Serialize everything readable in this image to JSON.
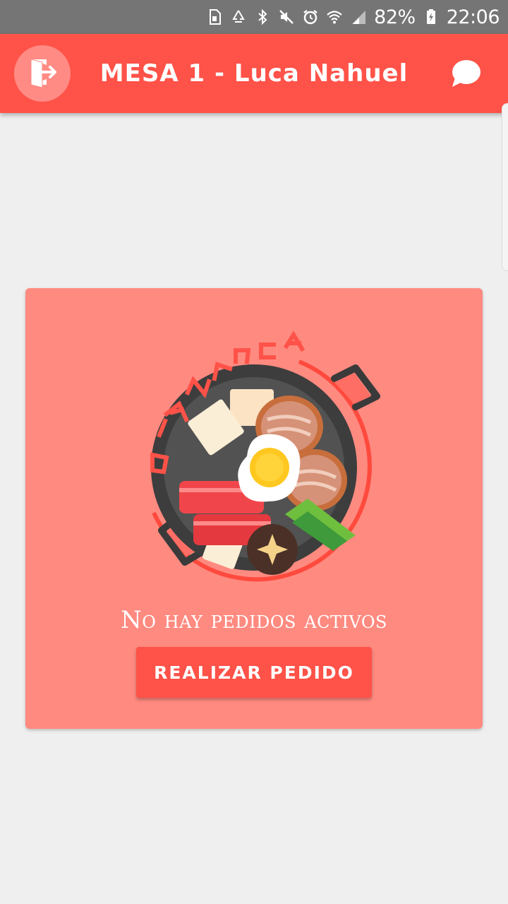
{
  "status_bar": {
    "icons": [
      "sd-card-icon",
      "recycle-icon",
      "bluetooth-icon",
      "mute-icon",
      "alarm-icon",
      "wifi-icon",
      "signal-icon",
      "battery-icon"
    ],
    "battery": "82%",
    "time": "22:06"
  },
  "app_bar": {
    "title": "MESA 1 - Luca Nahuel",
    "exit_icon": "exit-door-icon",
    "chat_icon": "chat-bubble-icon",
    "color": "#ff5248"
  },
  "card": {
    "logo_text": "BIANLUCA",
    "empty_message": "No hay pedidos activos",
    "button_label": "REALIZAR PEDIDO",
    "background": "#ff8a80"
  }
}
